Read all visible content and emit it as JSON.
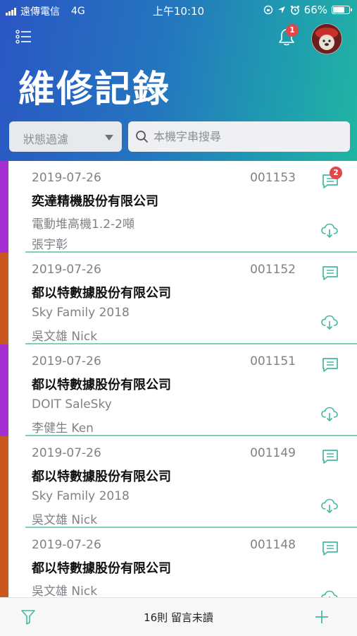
{
  "status_bar": {
    "carrier": "遠傳電信",
    "network": "4G",
    "time": "上午10:10",
    "battery": "66%"
  },
  "header": {
    "title": "維修記錄",
    "notification_count": "1"
  },
  "filter": {
    "label": "狀態過濾"
  },
  "search": {
    "placeholder": "本機字串搜尋"
  },
  "records": [
    {
      "date": "2019-07-26",
      "number": "001153",
      "company": "奕達精機股份有限公司",
      "product": "電動堆高機1.2-2噸",
      "person": "張宇彰",
      "message_count": "2",
      "strip_color": "#a52fd0"
    },
    {
      "date": "2019-07-26",
      "number": "001152",
      "company": "都以特數據股份有限公司",
      "product": "Sky Family 2018",
      "person": "吳文雄 Nick",
      "message_count": "",
      "strip_color": "#c9571f"
    },
    {
      "date": "2019-07-26",
      "number": "001151",
      "company": "都以特數據股份有限公司",
      "product": "DOIT SaleSky",
      "person": "李健生 Ken",
      "message_count": "",
      "strip_color": "#a52fd0"
    },
    {
      "date": "2019-07-26",
      "number": "001149",
      "company": "都以特數據股份有限公司",
      "product": "Sky Family 2018",
      "person": "吳文雄 Nick",
      "message_count": "",
      "strip_color": "#c9571f"
    },
    {
      "date": "2019-07-26",
      "number": "001148",
      "company": "都以特數據股份有限公司",
      "product": "",
      "person": "吳文雄 Nick",
      "message_count": "",
      "strip_color": "#c9571f"
    }
  ],
  "bottom_bar": {
    "unread_text": "16則 留言未讀"
  },
  "colors": {
    "accent": "#45b8a0",
    "badge": "#e34848",
    "header_start": "#2a56c4",
    "header_end": "#20b5a3"
  },
  "icons": {
    "menu": "list-menu-icon",
    "bell": "bell-icon",
    "chat": "chat-icon",
    "cloud": "cloud-download-icon",
    "filter": "funnel-icon",
    "add": "plus-icon",
    "search": "search-icon"
  }
}
